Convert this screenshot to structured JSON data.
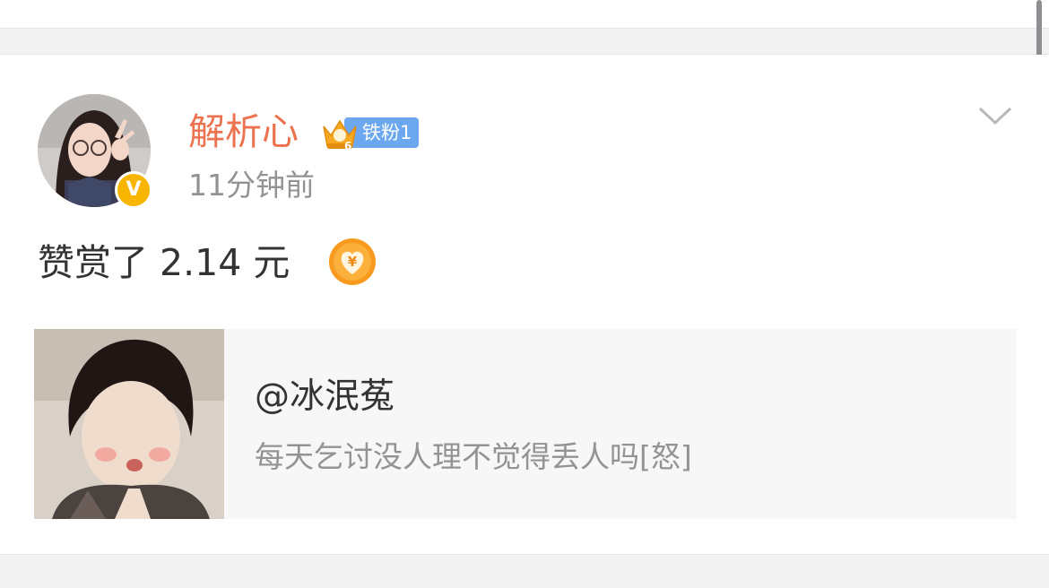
{
  "post": {
    "username": "解析心",
    "fan_badge": "铁粉1",
    "crown_level": "6",
    "time": "11分钟前",
    "verify_mark": "V",
    "content": "赞赏了 2.14 元",
    "coin_symbol": "¥"
  },
  "repost": {
    "user": "@冰泯菟",
    "text": "每天乞讨没人理不觉得丢人吗[怒]"
  },
  "colors": {
    "username": "#eb7350",
    "badge": "#6ca8f0",
    "verify": "#f7b500",
    "coin": "#f79a1e"
  }
}
